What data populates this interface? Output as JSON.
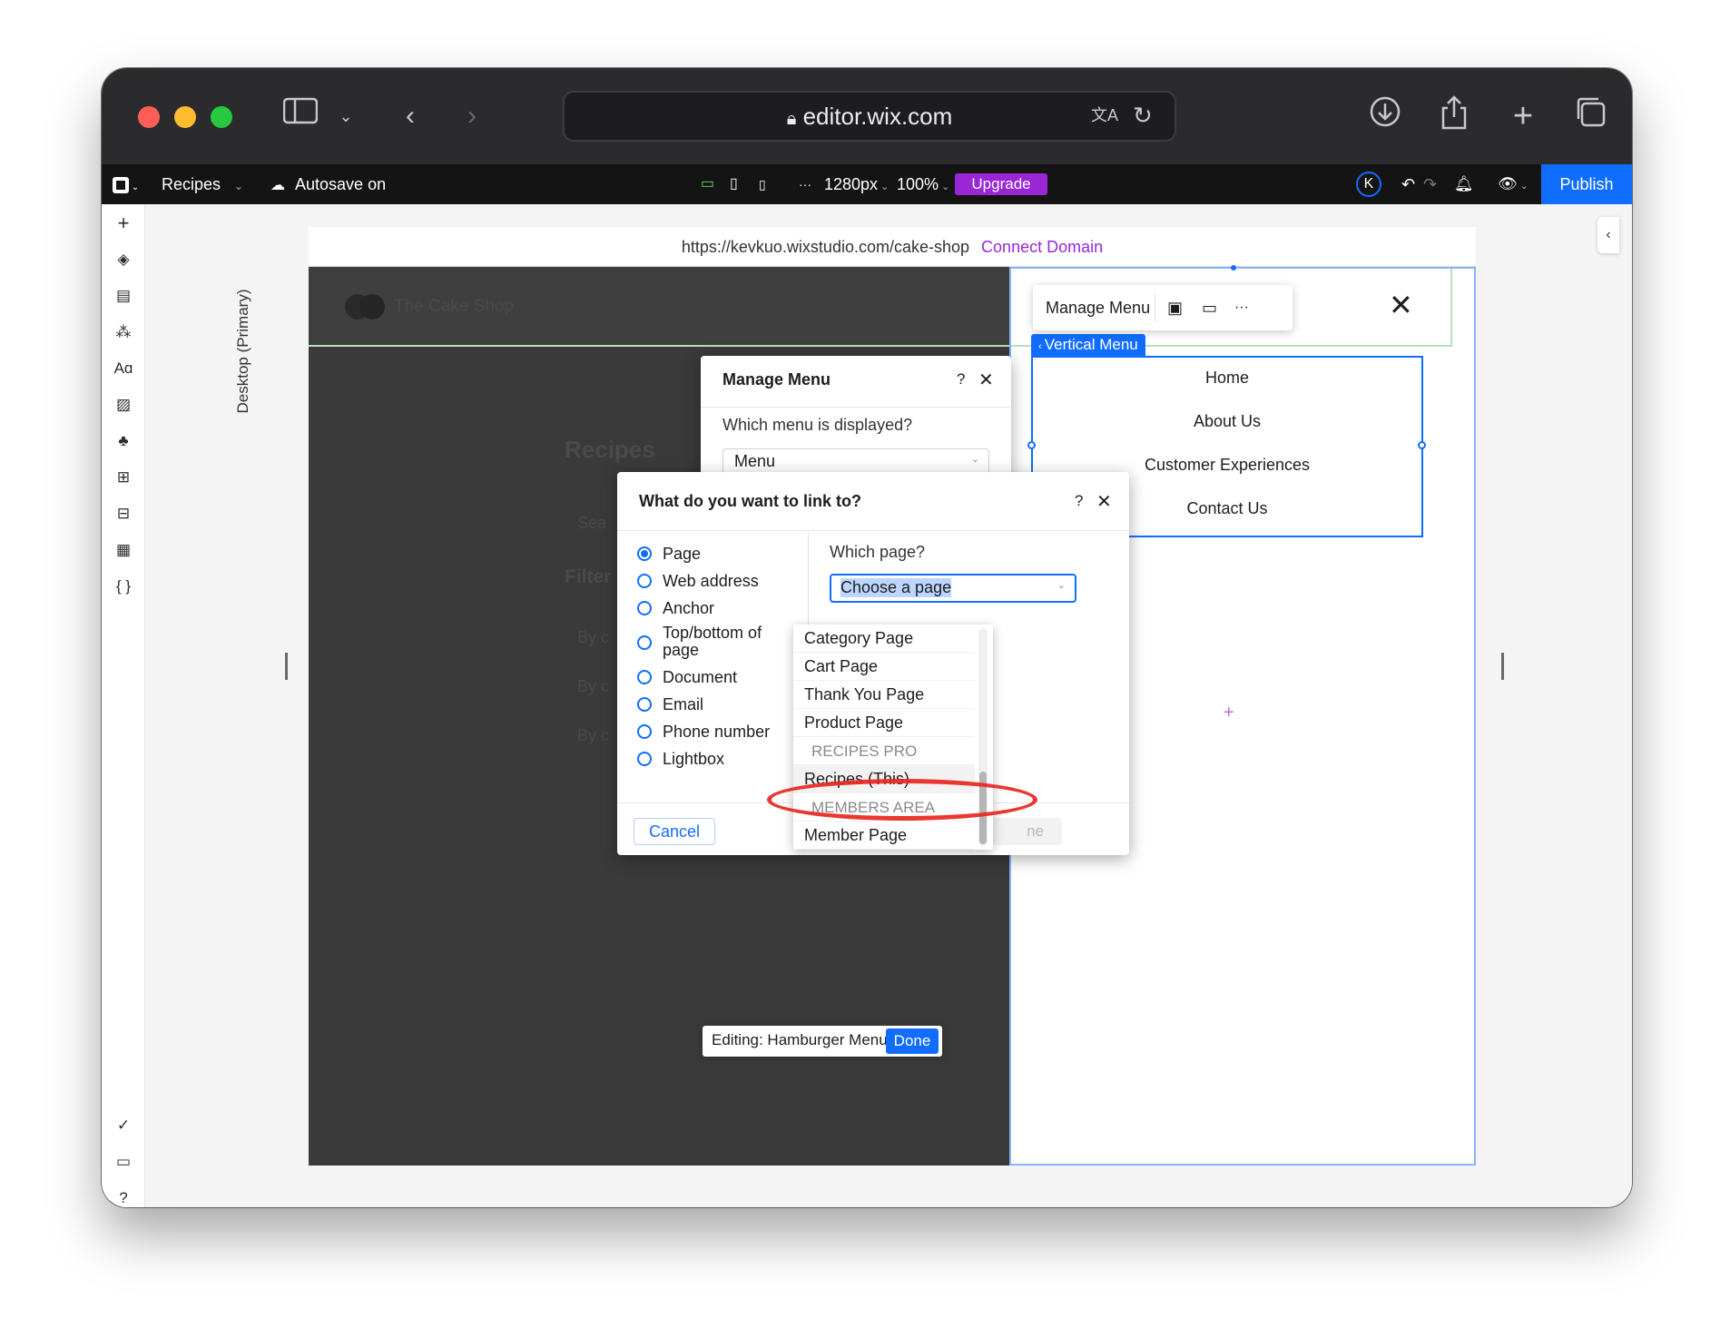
{
  "browser": {
    "url": "editor.wix.com"
  },
  "wix_bar": {
    "site_name": "Recipes",
    "autosave": "Autosave on",
    "width_value": "1280px",
    "zoom": "100%",
    "upgrade": "Upgrade",
    "avatar": "K",
    "publish": "Publish",
    "more": "···"
  },
  "address": {
    "site_url": "https://kevkuo.wixstudio.com/cake-shop",
    "connect": "Connect Domain"
  },
  "canvas": {
    "breakpoint_label": "Desktop (Primary)",
    "logo_text": "The Cake Shop",
    "heading": "Recipes",
    "search_hint": "Sea",
    "filter_hint": "Filter",
    "by1": "By c",
    "by2": "By c",
    "by3": "By c"
  },
  "floating_toolbar": {
    "manage_menu": "Manage Menu",
    "more": "···"
  },
  "vertical_menu": {
    "tag": "Vertical Menu",
    "items": [
      "Home",
      "About Us",
      "Customer Experiences",
      "Contact Us"
    ]
  },
  "manage_menu_dialog": {
    "title": "Manage Menu",
    "help": "?",
    "close": "✕",
    "question": "Which menu is displayed?",
    "selected": "Menu"
  },
  "link_dialog": {
    "title": "What do you want to link to?",
    "help": "?",
    "close": "✕",
    "options": [
      "Page",
      "Web address",
      "Anchor",
      "Top/bottom of page",
      "Document",
      "Email",
      "Phone number",
      "Lightbox"
    ],
    "selected_option": "Page",
    "which_page_label": "Which page?",
    "choose_placeholder": "Choose a page",
    "cancel": "Cancel",
    "done_partial": "ne"
  },
  "page_dropdown": {
    "items": [
      {
        "label": "Category Page",
        "group": false
      },
      {
        "label": "Cart Page",
        "group": false
      },
      {
        "label": "Thank You Page",
        "group": false
      },
      {
        "label": "Product Page",
        "group": false
      },
      {
        "label": "RECIPES PRO",
        "group": true
      },
      {
        "label": "Recipes (This)",
        "group": false
      },
      {
        "label": "MEMBERS AREA",
        "group": true
      },
      {
        "label": "Member Page",
        "group": false
      }
    ],
    "highlighted": "Recipes (This)"
  },
  "editing_bar": {
    "label": "Editing: Hamburger Menu",
    "done": "Done"
  },
  "colors": {
    "accent": "#116dff",
    "upgrade": "#9a27d5",
    "connect": "#9a27d5",
    "annotation": "#e8271f"
  }
}
